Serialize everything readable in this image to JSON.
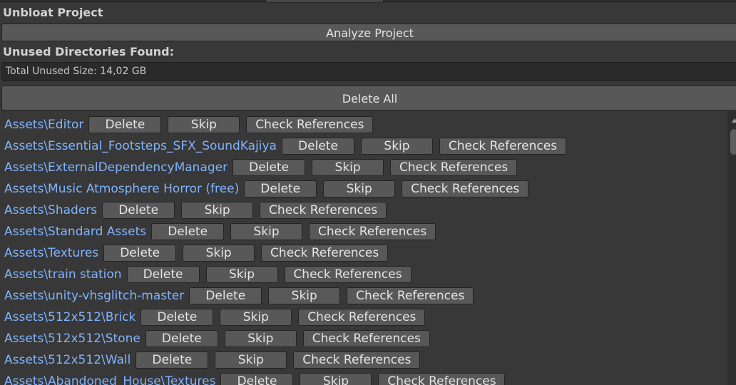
{
  "header": {
    "title": "Unbloat Project",
    "analyze_label": "Analyze Project",
    "unused_label": "Unused Directories Found:",
    "total_size": "Total Unused Size: 14,02 GB",
    "delete_all_label": "Delete All"
  },
  "actions": {
    "delete": "Delete",
    "skip": "Skip",
    "check": "Check References"
  },
  "directories": [
    "Assets\\Editor",
    "Assets\\Essential_Footsteps_SFX_SoundKajiya",
    "Assets\\ExternalDependencyManager",
    "Assets\\Music Atmosphere Horror (free)",
    "Assets\\Shaders",
    "Assets\\Standard Assets",
    "Assets\\Textures",
    "Assets\\train station",
    "Assets\\unity-vhsglitch-master",
    "Assets\\512x512\\Brick",
    "Assets\\512x512\\Stone",
    "Assets\\512x512\\Wall",
    "Assets\\Abandoned_House\\Textures"
  ],
  "colors": {
    "background": "#383838",
    "button": "#585858",
    "link": "#80b3ff"
  }
}
